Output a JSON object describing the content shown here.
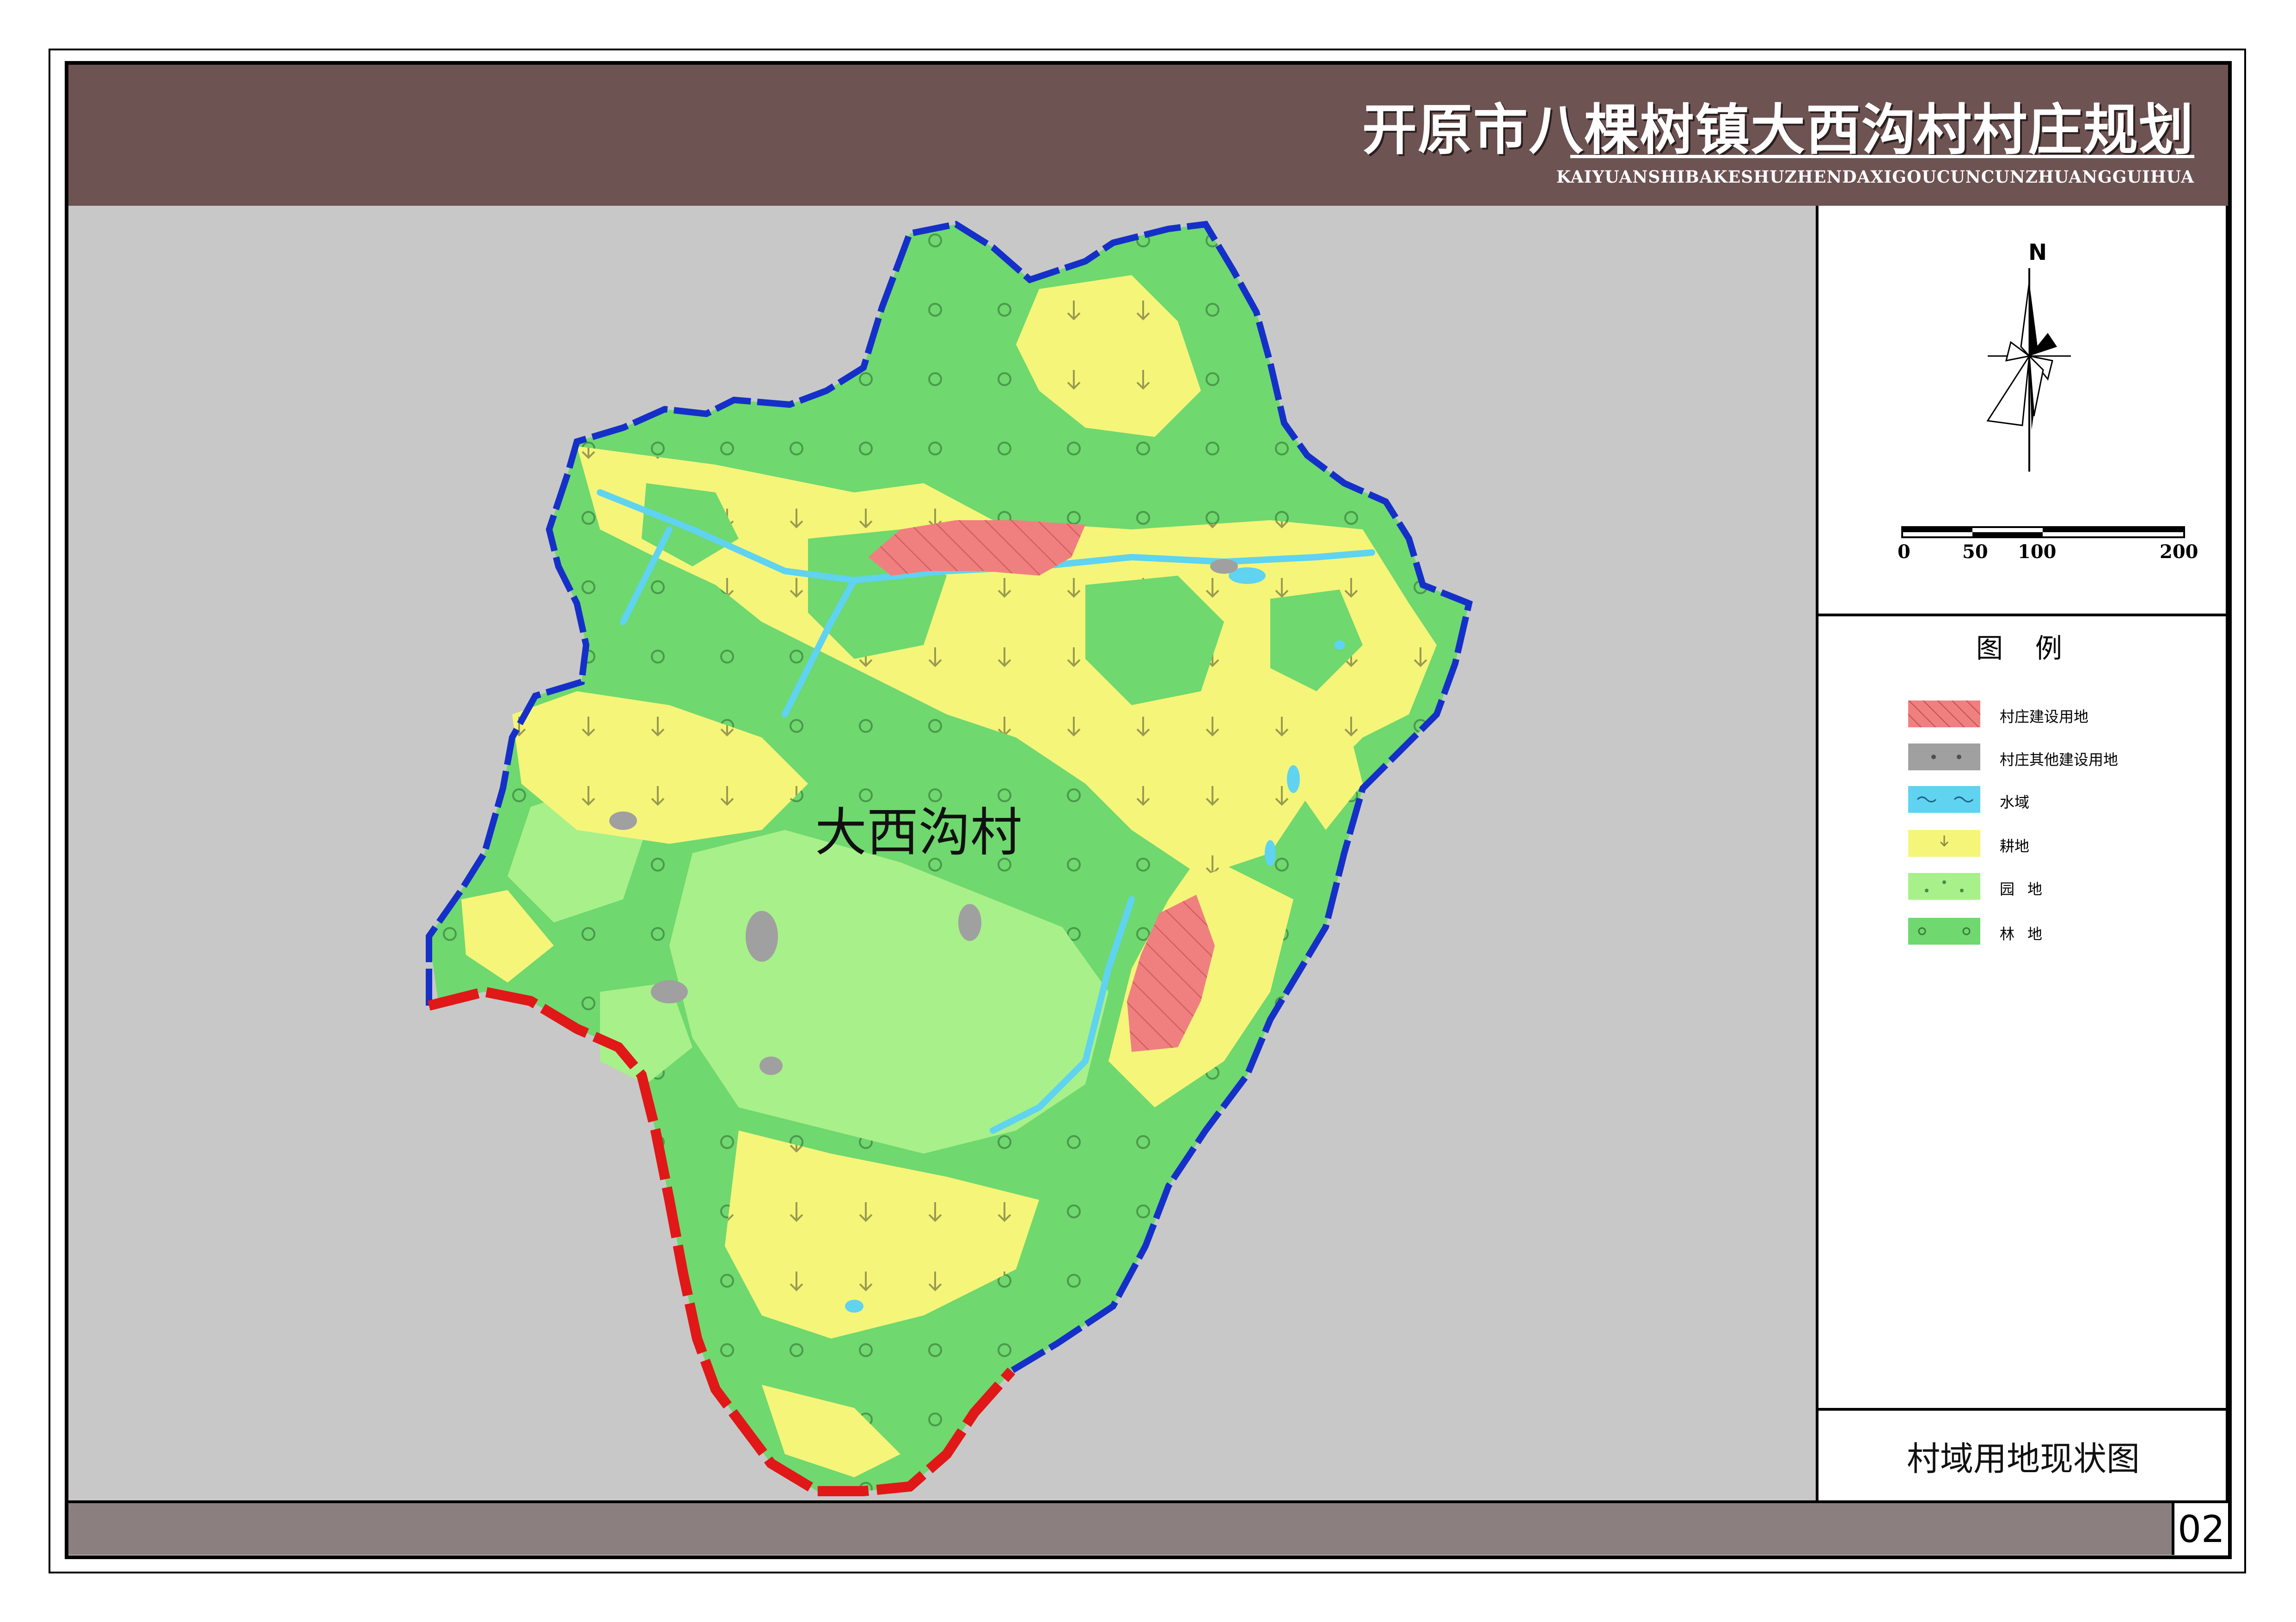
{
  "header": {
    "title": "开原市八棵树镇大西沟村村庄规划",
    "subtitle": "KAIYUANSHIBAKESHUZHENDAXIGOUCUNCUNZHUANGGUIHUA"
  },
  "map": {
    "village_label": "大西沟村"
  },
  "compass": {
    "north_label": "N"
  },
  "scale": {
    "ticks": [
      "0",
      "50",
      "100",
      "200"
    ]
  },
  "legend": {
    "title": "图例",
    "items": [
      {
        "label": "村庄建设用地",
        "color": "#f08080",
        "pattern": "hatch"
      },
      {
        "label": "村庄其他建设用地",
        "color": "#a0a0a0",
        "pattern": "dots"
      },
      {
        "label": "水域",
        "color": "#5fd3f0",
        "pattern": "wave"
      },
      {
        "label": "耕地",
        "color": "#f5f57a",
        "pattern": "arrow"
      },
      {
        "label": "园地",
        "color": "#a8f08a",
        "pattern": "dots"
      },
      {
        "label": "林地",
        "color": "#6fd86f",
        "pattern": "circles"
      }
    ]
  },
  "footer": {
    "drawing_name": "村域用地现状图",
    "page_number": "02"
  }
}
